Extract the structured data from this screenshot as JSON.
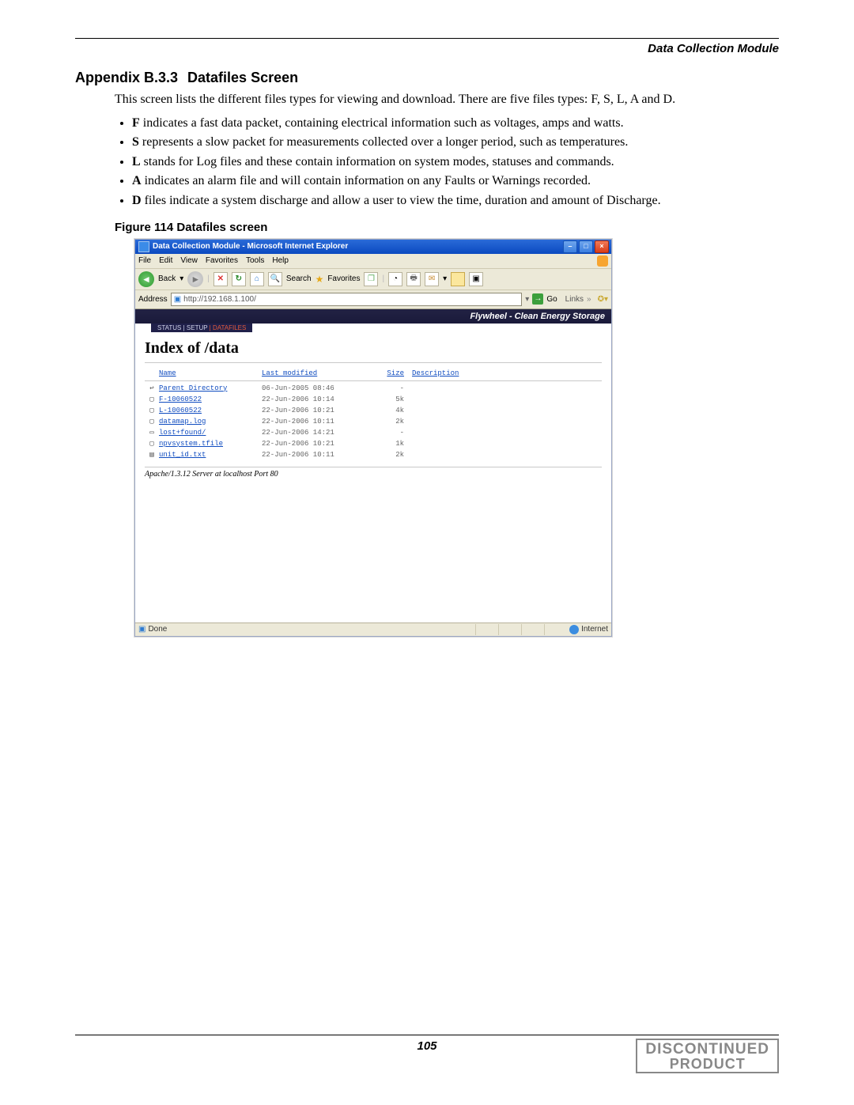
{
  "header": {
    "module": "Data Collection Module"
  },
  "section": {
    "number": "Appendix B.3.3",
    "title": "Datafiles Screen"
  },
  "intro": "This screen lists the different files types for viewing and download. There are five files types: F, S, L, A and D.",
  "bullets": [
    {
      "lead": "F",
      "text": " indicates a fast data packet, containing electrical information such as voltages, amps and watts."
    },
    {
      "lead": "S",
      "text": " represents a slow packet for measurements collected over a longer period, such as temperatures."
    },
    {
      "lead": "L",
      "text": " stands for Log files and these contain information on system modes, statuses and commands."
    },
    {
      "lead": "A",
      "text": " indicates an alarm file and will contain information on any Faults or Warnings recorded."
    },
    {
      "lead": "D",
      "text": " files indicate a system discharge and allow a user to view the time, duration and amount of Discharge."
    }
  ],
  "figure": {
    "caption": "Figure 114 Datafiles screen"
  },
  "browser": {
    "title": "Data Collection Module - Microsoft Internet Explorer",
    "menu": {
      "file": "File",
      "edit": "Edit",
      "view": "View",
      "favorites": "Favorites",
      "tools": "Tools",
      "help": "Help"
    },
    "toolbar": {
      "back": "Back",
      "search": "Search",
      "favorites": "Favorites"
    },
    "address": {
      "label": "Address",
      "value": "http://192.168.1.100/",
      "go": "Go",
      "links": "Links"
    },
    "banner": {
      "text": "Flywheel - Clean Energy Storage",
      "tab_left": "STATUS | SETUP",
      "tab_right": " | DATAFILES"
    },
    "index": {
      "heading": "Index of /data",
      "cols": {
        "name": "Name",
        "modified": "Last modified",
        "size": "Size",
        "desc": "Description"
      },
      "rows": [
        {
          "icon": "back-icon",
          "name": "Parent Directory",
          "date": "06-Jun-2005 08:46",
          "size": "-"
        },
        {
          "icon": "file-icon",
          "name": "F-10060522",
          "date": "22-Jun-2006 10:14",
          "size": "5k"
        },
        {
          "icon": "file-icon",
          "name": "L-10060522",
          "date": "22-Jun-2006 10:21",
          "size": "4k"
        },
        {
          "icon": "file-icon",
          "name": "datamap.log",
          "date": "22-Jun-2006 10:11",
          "size": "2k"
        },
        {
          "icon": "folder-icon",
          "name": "lost+found/",
          "date": "22-Jun-2006 14:21",
          "size": "-"
        },
        {
          "icon": "file-icon",
          "name": "npvsystem.tfile",
          "date": "22-Jun-2006 10:21",
          "size": "1k"
        },
        {
          "icon": "text-icon",
          "name": "unit_id.txt",
          "date": "22-Jun-2006 10:11",
          "size": "2k"
        }
      ],
      "server_line": "Apache/1.3.12 Server at localhost Port 80"
    },
    "status": {
      "done": "Done",
      "zone": "Internet"
    }
  },
  "footer": {
    "page": "105",
    "stamp1": "DISCONTINUED",
    "stamp2": "PRODUCT"
  }
}
